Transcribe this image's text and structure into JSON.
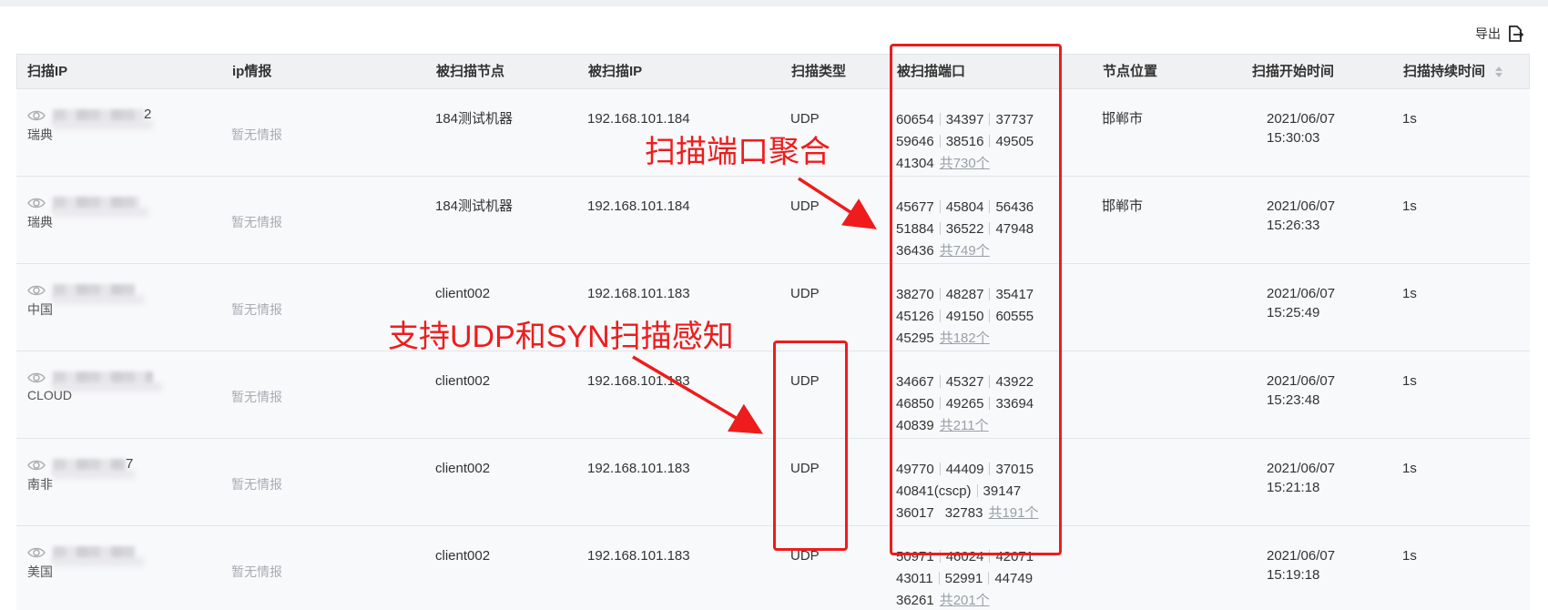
{
  "toolbar": {
    "export_label": "导出"
  },
  "table": {
    "headers": {
      "scan_ip": "扫描IP",
      "ip_intel": "ip情报",
      "scanned_node": "被扫描节点",
      "scanned_ip": "被扫描IP",
      "scan_type": "扫描类型",
      "scanned_ports": "被扫描端口",
      "node_location": "节点位置",
      "scan_start_time": "扫描开始时间",
      "scan_duration": "扫描持续时间"
    },
    "rows": [
      {
        "ip_suffix": "2",
        "country": "瑞典",
        "intel": "暂无情报",
        "node": "184测试机器",
        "target_ip": "192.168.101.184",
        "type": "UDP",
        "ports_line1": [
          "60654",
          "34397",
          "37737"
        ],
        "ports_line2": [
          "59646",
          "38516",
          "49505"
        ],
        "ports_line3": "41304",
        "ports_more": "共730个",
        "location": "邯郸市",
        "date": "2021/06/07",
        "time": "15:30:03",
        "duration": "1s"
      },
      {
        "ip_suffix": "",
        "country": "瑞典",
        "intel": "暂无情报",
        "node": "184测试机器",
        "target_ip": "192.168.101.184",
        "type": "UDP",
        "ports_line1": [
          "45677",
          "45804",
          "56436"
        ],
        "ports_line2": [
          "51884",
          "36522",
          "47948"
        ],
        "ports_line3": "36436",
        "ports_more": "共749个",
        "location": "邯郸市",
        "date": "2021/06/07",
        "time": "15:26:33",
        "duration": "1s"
      },
      {
        "ip_suffix": "",
        "country": "中国",
        "intel": "暂无情报",
        "node": "client002",
        "target_ip": "192.168.101.183",
        "type": "UDP",
        "ports_line1": [
          "38270",
          "48287",
          "35417"
        ],
        "ports_line2": [
          "45126",
          "49150",
          "60555"
        ],
        "ports_line3": "45295",
        "ports_more": "共182个",
        "location": "",
        "date": "2021/06/07",
        "time": "15:25:49",
        "duration": "1s"
      },
      {
        "ip_suffix": "",
        "country": "CLOUD",
        "intel": "暂无情报",
        "node": "client002",
        "target_ip": "192.168.101.183",
        "type": "UDP",
        "ports_line1": [
          "34667",
          "45327",
          "43922"
        ],
        "ports_line2": [
          "46850",
          "49265",
          "33694"
        ],
        "ports_line3": "40839",
        "ports_more": "共211个",
        "location": "",
        "date": "2021/06/07",
        "time": "15:23:48",
        "duration": "1s"
      },
      {
        "ip_suffix": "7",
        "country": "南非",
        "intel": "暂无情报",
        "node": "client002",
        "target_ip": "192.168.101.183",
        "type": "UDP",
        "ports_line1": [
          "49770",
          "44409",
          "37015"
        ],
        "ports_line2": [
          "40841(cscp)",
          "39147"
        ],
        "ports_line3a": "36017",
        "ports_line3": "32783",
        "ports_more": "共191个",
        "location": "",
        "date": "2021/06/07",
        "time": "15:21:18",
        "duration": "1s"
      },
      {
        "ip_suffix": "",
        "country": "美国",
        "intel": "暂无情报",
        "node": "client002",
        "target_ip": "192.168.101.183",
        "type": "UDP",
        "ports_line1": [
          "50971",
          "46024",
          "42071"
        ],
        "ports_line2": [
          "43011",
          "52991",
          "44749"
        ],
        "ports_line3": "36261",
        "ports_more": "共201个",
        "location": "",
        "date": "2021/06/07",
        "time": "15:19:18",
        "duration": "1s"
      }
    ]
  },
  "annotations": {
    "port_aggregation": "扫描端口聚合",
    "udp_syn_support": "支持UDP和SYN扫描感知",
    "accent_color": "#ee1c1c"
  }
}
